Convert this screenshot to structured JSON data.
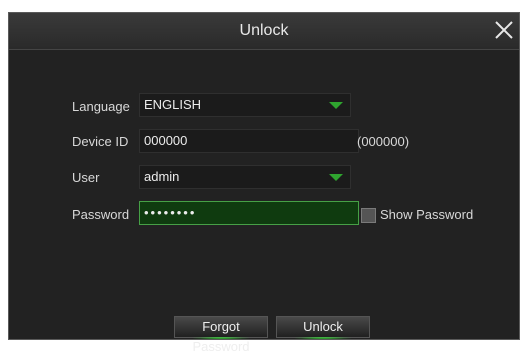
{
  "dialog": {
    "title": "Unlock"
  },
  "form": {
    "language": {
      "label": "Language",
      "value": "ENGLISH"
    },
    "device_id": {
      "label": "Device ID",
      "value": "000000",
      "hint": "(000000)"
    },
    "user": {
      "label": "User",
      "value": "admin"
    },
    "password": {
      "label": "Password",
      "value": "••••••••"
    },
    "show_password_label": "Show Password"
  },
  "buttons": {
    "forgot": "Forgot Password",
    "unlock": "Unlock"
  },
  "icons": {
    "close": "close-icon",
    "dropdown": "chevron-down-icon"
  },
  "colors": {
    "accent": "#2fa52f",
    "dialog_bg": "#222222",
    "password_bg": "#0f3b0f"
  }
}
